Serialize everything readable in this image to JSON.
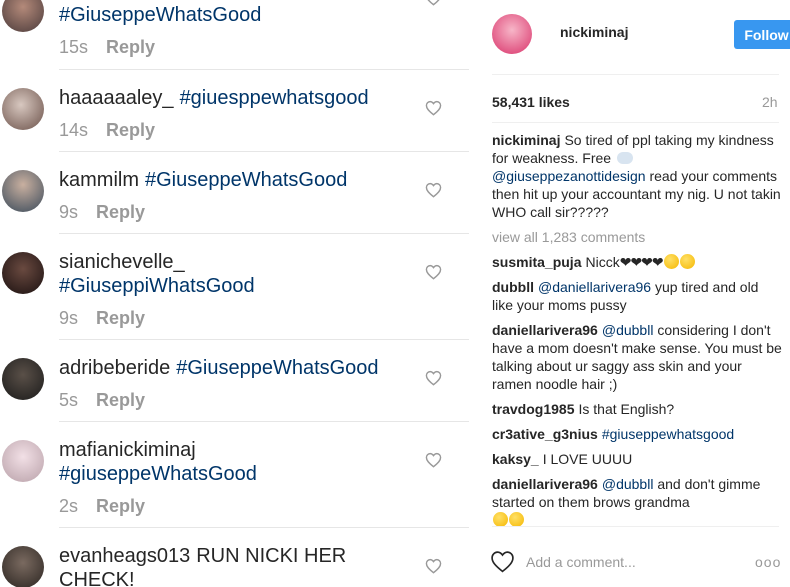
{
  "comments": [
    {
      "user": "",
      "text": "#GiuseppeWhatsGood",
      "time": "15s",
      "reply": "Reply",
      "top_partial": true
    },
    {
      "user": "haaaaaaley_",
      "text": "#giuesppewhatsgood",
      "time": "14s",
      "reply": "Reply"
    },
    {
      "user": "kammilm",
      "text": "#GiuseppeWhatsGood",
      "time": "9s",
      "reply": "Reply"
    },
    {
      "user": "sianichevelle_",
      "text": "#GiuseppiWhatsGood",
      "time": "9s",
      "reply": "Reply"
    },
    {
      "user": "adribeberide",
      "text": "#GiuseppeWhatsGood",
      "time": "5s",
      "reply": "Reply"
    },
    {
      "user": "mafianickiminaj",
      "text": "#giuseppeWhatsGood",
      "time": "2s",
      "reply": "Reply"
    },
    {
      "user": "evanheags013",
      "text": "RUN NICKI HER CHECK!",
      "time": "",
      "reply": ""
    }
  ],
  "post": {
    "username": "nickiminaj",
    "follow_label": "Follow",
    "likes": "58,431 likes",
    "age": "2h",
    "caption": {
      "user": "nickiminaj",
      "text1": "So tired of ppl taking my kindness for weakness. Free",
      "mention": "@giuseppezanottidesign",
      "text2": "read your comments then hit up your accountant my nig. U not takin WHO call sir?????"
    },
    "view_all": "view all 1,283 comments",
    "thread": [
      {
        "user": "susmita_puja",
        "text": "Nicck",
        "hearts": "❤❤❤❤",
        "emoji_count": 2
      },
      {
        "user": "dubbll",
        "mention": "@daniellarivera96",
        "text": "yup tired and old like your moms pussy"
      },
      {
        "user": "daniellarivera96",
        "mention": "@dubbll",
        "text": "considering I don't have a mom doesn't make sense. You must be talking about ur saggy ass skin and your ramen noodle hair ;)"
      },
      {
        "user": "travdog1985",
        "text": "Is that English?"
      },
      {
        "user": "cr3ative_g3nius",
        "mention": "#giuseppewhatsgood",
        "text": ""
      },
      {
        "user": "kaksy_",
        "text": "I LOVE UUUU"
      },
      {
        "user": "daniellarivera96",
        "mention": "@dubbll",
        "text": "and don't gimme started on them brows grandma",
        "emoji_count": 2
      }
    ],
    "add_comment_placeholder": "Add a comment...",
    "more_label": "ooo"
  },
  "colors": {
    "accent": "#3897f0",
    "link": "#003569",
    "muted": "#999999",
    "text": "#262626"
  },
  "icons": {
    "like": "heart-outline-icon",
    "more": "more-options-icon"
  }
}
